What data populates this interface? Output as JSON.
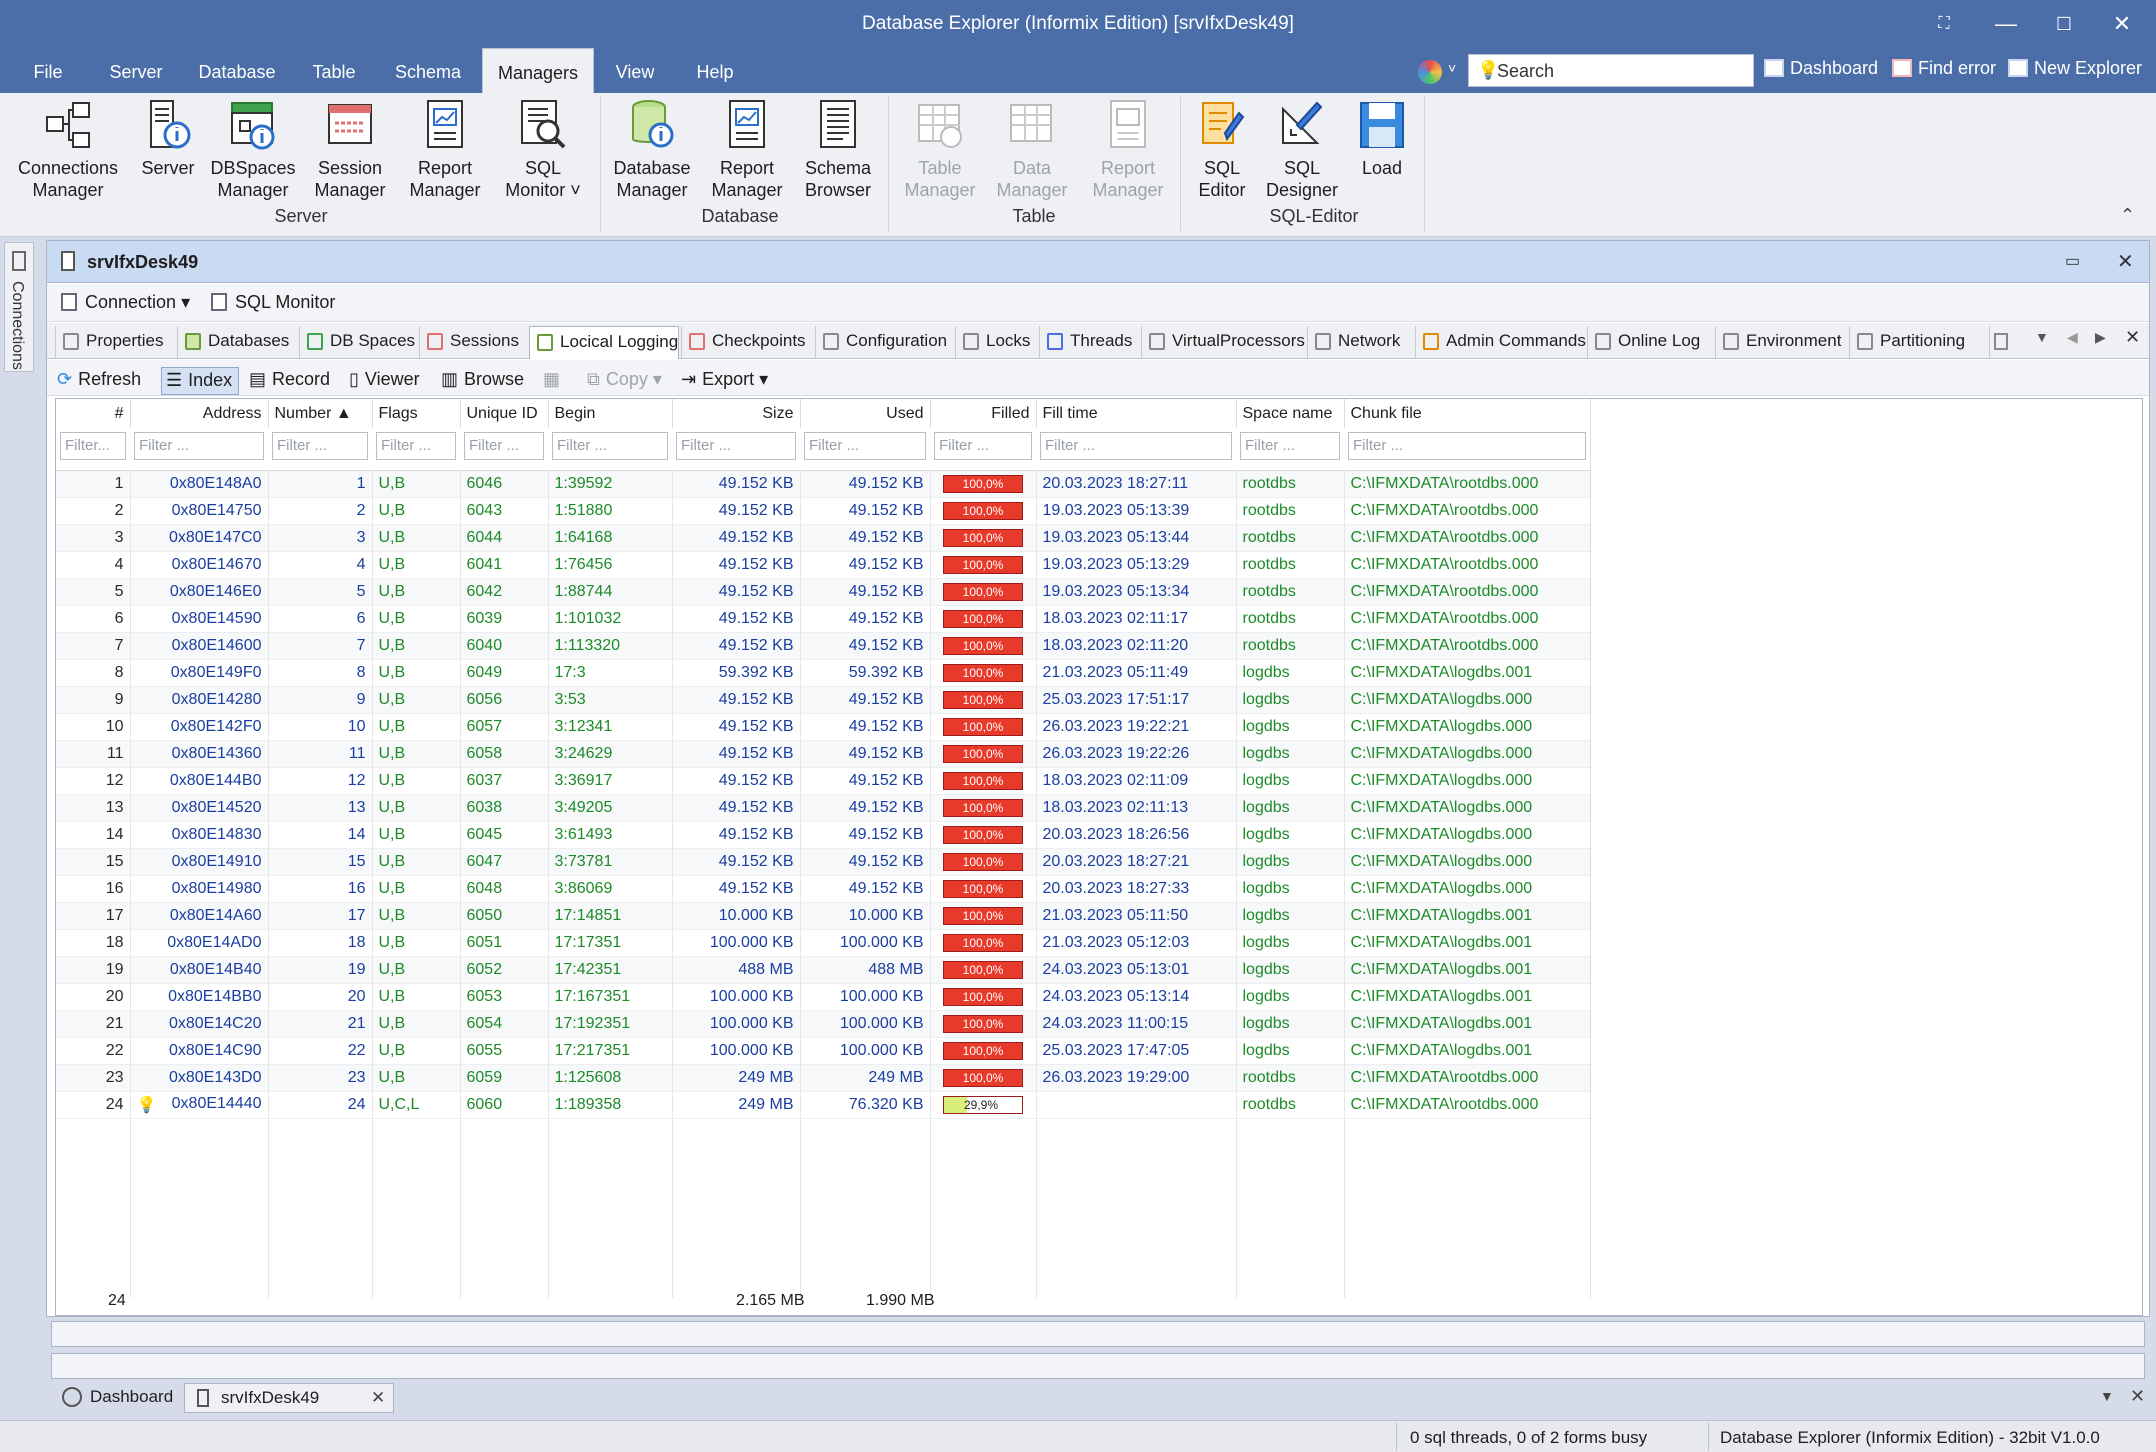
{
  "window": {
    "title": "Database Explorer (Informix Edition) [srvIfxDesk49]"
  },
  "menu": [
    "File",
    "Server",
    "Database",
    "Table",
    "Schema",
    "Managers",
    "View",
    "Help"
  ],
  "active_menu": "Managers",
  "search": {
    "label": "Search"
  },
  "toplinks": {
    "dashboard": "Dashboard",
    "find_error": "Find error",
    "new_explorer": "New Explorer"
  },
  "ribbon": {
    "server": {
      "conn": [
        "Connections",
        "Manager"
      ],
      "server": [
        "Server"
      ],
      "dbspaces": [
        "DBSpaces",
        "Manager"
      ],
      "session": [
        "Session",
        "Manager"
      ],
      "report": [
        "Report",
        "Manager"
      ],
      "sqlmon": [
        "SQL",
        "Monitor ˅"
      ],
      "group": "Server"
    },
    "database": {
      "dbm": [
        "Database",
        "Manager"
      ],
      "report": [
        "Report",
        "Manager"
      ],
      "schema": [
        "Schema",
        "Browser"
      ],
      "group": "Database"
    },
    "table": {
      "tm": [
        "Table",
        "Manager"
      ],
      "dm": [
        "Data",
        "Manager"
      ],
      "rm": [
        "Report",
        "Manager"
      ],
      "group": "Table"
    },
    "sqleditor": {
      "editor": [
        "SQL",
        "Editor"
      ],
      "designer": [
        "SQL",
        "Designer"
      ],
      "load": [
        "Load"
      ],
      "group": "SQL-Editor"
    }
  },
  "leftdock": {
    "label": "Connections"
  },
  "doc": {
    "title": "srvIfxDesk49"
  },
  "toolbar1": {
    "connection": "Connection ▾",
    "sqlmonitor": "SQL Monitor"
  },
  "tabs": [
    "Properties",
    "Databases",
    "DB Spaces",
    "Sessions",
    "Locical Logging",
    "Checkpoints",
    "Configuration",
    "Locks",
    "Threads",
    "VirtualProcessors",
    "Network",
    "Admin Commands",
    "Online Log",
    "Environment",
    "Partitioning"
  ],
  "active_tab": "Locical Logging",
  "toolbar2": {
    "refresh": "Refresh",
    "index": "Index",
    "record": "Record",
    "viewer": "Viewer",
    "browse": "Browse",
    "copy": "Copy ▾",
    "export": "Export ▾"
  },
  "grid": {
    "columns": [
      "#",
      "Address",
      "Number ▲",
      "Flags",
      "Unique ID",
      "Begin",
      "Size",
      "Used",
      "Filled",
      "Fill time",
      "Space name",
      "Chunk file"
    ],
    "filters": [
      "Filter...",
      "Filter ...",
      "Filter ...",
      "Filter ...",
      "Filter ...",
      "Filter ...",
      "Filter ...",
      "Filter ...",
      "Filter ...",
      "Filter ...",
      "Filter ...",
      "Filter ..."
    ],
    "rows": [
      [
        "1",
        "0x80E148A0",
        "1",
        "U,B",
        "6046",
        "1:39592",
        "49.152 KB",
        "49.152 KB",
        "100,0%",
        "20.03.2023 18:27:11",
        "rootdbs",
        "C:\\IFMXDATA\\rootdbs.000"
      ],
      [
        "2",
        "0x80E14750",
        "2",
        "U,B",
        "6043",
        "1:51880",
        "49.152 KB",
        "49.152 KB",
        "100,0%",
        "19.03.2023 05:13:39",
        "rootdbs",
        "C:\\IFMXDATA\\rootdbs.000"
      ],
      [
        "3",
        "0x80E147C0",
        "3",
        "U,B",
        "6044",
        "1:64168",
        "49.152 KB",
        "49.152 KB",
        "100,0%",
        "19.03.2023 05:13:44",
        "rootdbs",
        "C:\\IFMXDATA\\rootdbs.000"
      ],
      [
        "4",
        "0x80E14670",
        "4",
        "U,B",
        "6041",
        "1:76456",
        "49.152 KB",
        "49.152 KB",
        "100,0%",
        "19.03.2023 05:13:29",
        "rootdbs",
        "C:\\IFMXDATA\\rootdbs.000"
      ],
      [
        "5",
        "0x80E146E0",
        "5",
        "U,B",
        "6042",
        "1:88744",
        "49.152 KB",
        "49.152 KB",
        "100,0%",
        "19.03.2023 05:13:34",
        "rootdbs",
        "C:\\IFMXDATA\\rootdbs.000"
      ],
      [
        "6",
        "0x80E14590",
        "6",
        "U,B",
        "6039",
        "1:101032",
        "49.152 KB",
        "49.152 KB",
        "100,0%",
        "18.03.2023 02:11:17",
        "rootdbs",
        "C:\\IFMXDATA\\rootdbs.000"
      ],
      [
        "7",
        "0x80E14600",
        "7",
        "U,B",
        "6040",
        "1:113320",
        "49.152 KB",
        "49.152 KB",
        "100,0%",
        "18.03.2023 02:11:20",
        "rootdbs",
        "C:\\IFMXDATA\\rootdbs.000"
      ],
      [
        "8",
        "0x80E149F0",
        "8",
        "U,B",
        "6049",
        "17:3",
        "59.392 KB",
        "59.392 KB",
        "100,0%",
        "21.03.2023 05:11:49",
        "logdbs",
        "C:\\IFMXDATA\\logdbs.001"
      ],
      [
        "9",
        "0x80E14280",
        "9",
        "U,B",
        "6056",
        "3:53",
        "49.152 KB",
        "49.152 KB",
        "100,0%",
        "25.03.2023 17:51:17",
        "logdbs",
        "C:\\IFMXDATA\\logdbs.000"
      ],
      [
        "10",
        "0x80E142F0",
        "10",
        "U,B",
        "6057",
        "3:12341",
        "49.152 KB",
        "49.152 KB",
        "100,0%",
        "26.03.2023 19:22:21",
        "logdbs",
        "C:\\IFMXDATA\\logdbs.000"
      ],
      [
        "11",
        "0x80E14360",
        "11",
        "U,B",
        "6058",
        "3:24629",
        "49.152 KB",
        "49.152 KB",
        "100,0%",
        "26.03.2023 19:22:26",
        "logdbs",
        "C:\\IFMXDATA\\logdbs.000"
      ],
      [
        "12",
        "0x80E144B0",
        "12",
        "U,B",
        "6037",
        "3:36917",
        "49.152 KB",
        "49.152 KB",
        "100,0%",
        "18.03.2023 02:11:09",
        "logdbs",
        "C:\\IFMXDATA\\logdbs.000"
      ],
      [
        "13",
        "0x80E14520",
        "13",
        "U,B",
        "6038",
        "3:49205",
        "49.152 KB",
        "49.152 KB",
        "100,0%",
        "18.03.2023 02:11:13",
        "logdbs",
        "C:\\IFMXDATA\\logdbs.000"
      ],
      [
        "14",
        "0x80E14830",
        "14",
        "U,B",
        "6045",
        "3:61493",
        "49.152 KB",
        "49.152 KB",
        "100,0%",
        "20.03.2023 18:26:56",
        "logdbs",
        "C:\\IFMXDATA\\logdbs.000"
      ],
      [
        "15",
        "0x80E14910",
        "15",
        "U,B",
        "6047",
        "3:73781",
        "49.152 KB",
        "49.152 KB",
        "100,0%",
        "20.03.2023 18:27:21",
        "logdbs",
        "C:\\IFMXDATA\\logdbs.000"
      ],
      [
        "16",
        "0x80E14980",
        "16",
        "U,B",
        "6048",
        "3:86069",
        "49.152 KB",
        "49.152 KB",
        "100,0%",
        "20.03.2023 18:27:33",
        "logdbs",
        "C:\\IFMXDATA\\logdbs.000"
      ],
      [
        "17",
        "0x80E14A60",
        "17",
        "U,B",
        "6050",
        "17:14851",
        "10.000 KB",
        "10.000 KB",
        "100,0%",
        "21.03.2023 05:11:50",
        "logdbs",
        "C:\\IFMXDATA\\logdbs.001"
      ],
      [
        "18",
        "0x80E14AD0",
        "18",
        "U,B",
        "6051",
        "17:17351",
        "100.000 KB",
        "100.000 KB",
        "100,0%",
        "21.03.2023 05:12:03",
        "logdbs",
        "C:\\IFMXDATA\\logdbs.001"
      ],
      [
        "19",
        "0x80E14B40",
        "19",
        "U,B",
        "6052",
        "17:42351",
        "488 MB",
        "488 MB",
        "100,0%",
        "24.03.2023 05:13:01",
        "logdbs",
        "C:\\IFMXDATA\\logdbs.001"
      ],
      [
        "20",
        "0x80E14BB0",
        "20",
        "U,B",
        "6053",
        "17:167351",
        "100.000 KB",
        "100.000 KB",
        "100,0%",
        "24.03.2023 05:13:14",
        "logdbs",
        "C:\\IFMXDATA\\logdbs.001"
      ],
      [
        "21",
        "0x80E14C20",
        "21",
        "U,B",
        "6054",
        "17:192351",
        "100.000 KB",
        "100.000 KB",
        "100,0%",
        "24.03.2023 11:00:15",
        "logdbs",
        "C:\\IFMXDATA\\logdbs.001"
      ],
      [
        "22",
        "0x80E14C90",
        "22",
        "U,B",
        "6055",
        "17:217351",
        "100.000 KB",
        "100.000 KB",
        "100,0%",
        "25.03.2023 17:47:05",
        "logdbs",
        "C:\\IFMXDATA\\logdbs.001"
      ],
      [
        "23",
        "0x80E143D0",
        "23",
        "U,B",
        "6059",
        "1:125608",
        "249 MB",
        "249 MB",
        "100,0%",
        "26.03.2023 19:29:00",
        "rootdbs",
        "C:\\IFMXDATA\\rootdbs.000"
      ],
      [
        "24",
        "0x80E14440",
        "24",
        "U,C,L",
        "6060",
        "1:189358",
        "249 MB",
        "76.320 KB",
        "29,9%",
        "",
        "rootdbs",
        "C:\\IFMXDATA\\rootdbs.000"
      ]
    ],
    "fill_fraction": [
      1,
      1,
      1,
      1,
      1,
      1,
      1,
      1,
      1,
      1,
      1,
      1,
      1,
      1,
      1,
      1,
      1,
      1,
      1,
      1,
      1,
      1,
      1,
      0.299
    ],
    "current_row_icon_row": 24,
    "footer": {
      "count": "24",
      "size_total": "2.165 MB",
      "used_total": "1.990 MB"
    }
  },
  "doctabs": {
    "dashboard": "Dashboard",
    "server": "srvIfxDesk49"
  },
  "status": {
    "threads": "0 sql threads, 0 of 2 forms busy",
    "product": "Database Explorer (Informix Edition) - 32bit V1.0.0"
  },
  "colors": {
    "title_bar": "#4b6ea8",
    "doc_header": "#c9daf3",
    "fill_full": "#e83a2a",
    "fill_partial": "#d8ef7a",
    "text_blue": "#1a3ea0",
    "text_green": "#1d8a28"
  }
}
